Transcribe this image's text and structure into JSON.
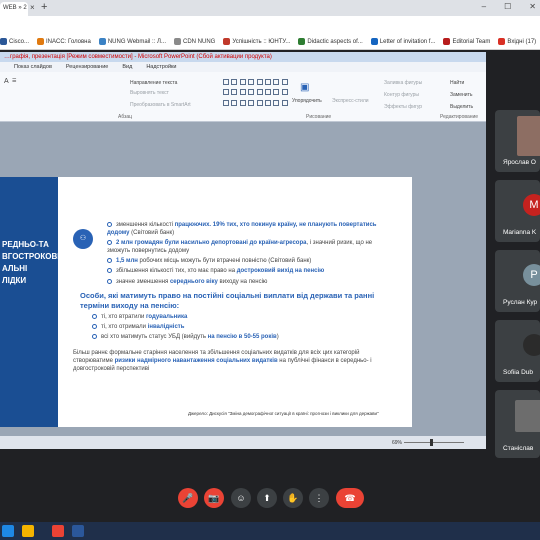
{
  "browser": {
    "tab_title": "WEB » 2",
    "close_glyph": "×",
    "new_tab_glyph": "+",
    "window_controls": [
      "‒",
      "☐",
      "✕"
    ]
  },
  "bookmarks": [
    {
      "label": "Cisco...",
      "color": "#2b5797"
    },
    {
      "label": "INACC: Головна",
      "color": "#e07a10"
    },
    {
      "label": "NUNG Webmail :: Л...",
      "color": "#3b82c4"
    },
    {
      "label": "CDN NUNG",
      "color": "#8a8a8a"
    },
    {
      "label": "Успішність :: ЮНТУ...",
      "color": "#c0392b"
    },
    {
      "label": "Didactic aspects of...",
      "color": "#2e7d32"
    },
    {
      "label": "Letter of invitation f...",
      "color": "#1565c0"
    },
    {
      "label": "Editorial Team",
      "color": "#b71c1c"
    },
    {
      "label": "Вхідні (17)",
      "color": "#d93025"
    }
  ],
  "ppt": {
    "title": "…графія, презентація [Режим совместимости] - Microsoft PowerPoint (Сбой активации продукта)",
    "menus": [
      "Показ слайдов",
      "Рецензирование",
      "Вид",
      "Надстройки"
    ],
    "ribbon": {
      "direction": "Направление текста",
      "align": "Выровнять текст",
      "smartart": "Преобразовать в SmartArt",
      "paragraph": "Абзац",
      "drawing": "Рисование",
      "arrange": "Упорядочить",
      "quick_styles": "Экспресс-стили",
      "fill": "Заливка фигуры",
      "outline": "Контур фигуры",
      "effects": "Эффекты фигур",
      "find": "Найти",
      "replace": "Заменить",
      "select": "Выделить",
      "editing": "Редактирование"
    },
    "status": {
      "zoom": "69%"
    }
  },
  "slide": {
    "left_title": [
      "РЕДНЬО-ТА",
      "ВГОСТРОКОВІ",
      "АЛЬНІ",
      "ЛІДКИ"
    ],
    "bullets": [
      {
        "pre": "зменшення кількості ",
        "bold": "працюючих. 19% тих, хто покинув країну, не планують повертатись додому",
        "post": " (Світовий банк)"
      },
      {
        "pre": "",
        "bold": "2 млн громадян були насильно депортовані до країни-агресора",
        "post": ", і значний ризик, що не зможуть повернутись додому"
      },
      {
        "pre": "",
        "bold": "1,5 млн",
        "post": " робочих місць можуть бути втрачені повністю (Світовий банк)"
      },
      {
        "pre": "збільшення кількості тих, хто має право на ",
        "bold": "достроковий вихід на пенсію",
        "post": ""
      },
      {
        "pre": "значне зменшення ",
        "bold": "середнього віку",
        "post": " виходу на пенсію"
      }
    ],
    "heading2": "Особи, які матимуть право на постійні соціальні виплати від держави та ранні терміни виходу на пенсію:",
    "sub_bullets": [
      {
        "pre": "ті, хто втратили ",
        "bold": "годувальника",
        "post": ""
      },
      {
        "pre": "ті, хто отримали ",
        "bold": "інвалідність",
        "post": ""
      },
      {
        "pre": "всі хто матимуть статус УБД (вийдуть ",
        "bold": "на пенсію в 50-55 років",
        "post": ")"
      }
    ],
    "summary_pre": "Більш раннє формальне старіння населення та збільшення соціальних видатків для всіх цих категорій створюватиме ",
    "summary_bold": "ризики надмірного навантаження соціальних видатків",
    "summary_post": " на публічні фінанси в середньо- і довгостроковій перспективі",
    "source": "Джерело: Дискусія \"Зміна демографічної ситуації в країні: прогнози і виклики для держави\""
  },
  "participants": [
    {
      "name": "Ярослав О",
      "initial": "",
      "color": "#5f6368"
    },
    {
      "name": "Marianna K",
      "initial": "M",
      "color": "#c5221f"
    },
    {
      "name": "Руслан Кур",
      "initial": "Р",
      "color": "#78909c"
    },
    {
      "name": "Sofiia Dub",
      "initial": "",
      "color": "#2b2b2b"
    },
    {
      "name": "Станіслав",
      "initial": "",
      "color": "#5f6368"
    }
  ],
  "controls": {
    "mic": "🎤",
    "cam": "📷",
    "emoji": "☺",
    "present": "⬆",
    "hand": "✋",
    "more": "⋮",
    "hangup": "☎"
  }
}
